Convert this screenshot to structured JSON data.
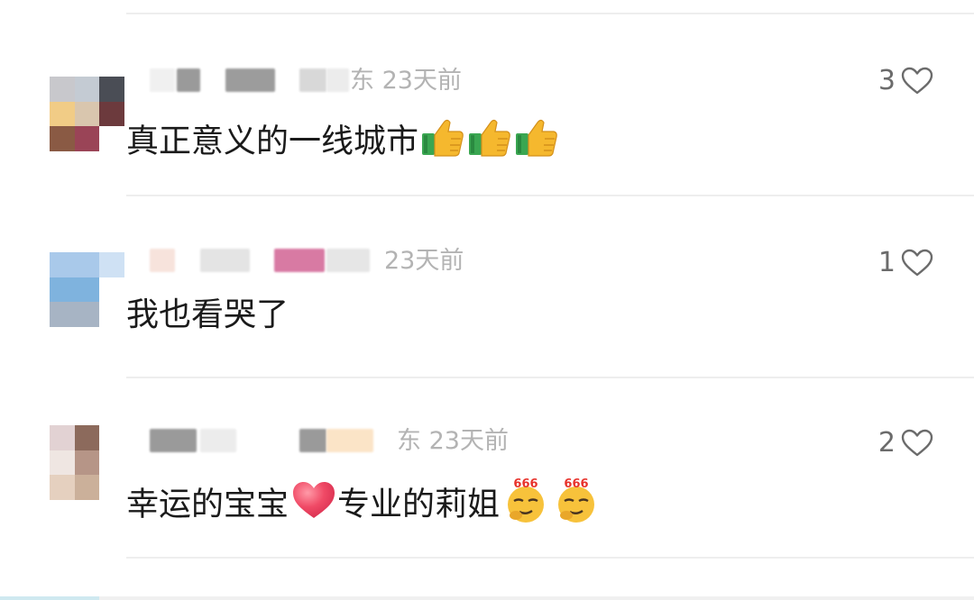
{
  "comments": [
    {
      "location_time": "东 23天前",
      "text": "真正意义的一线城市",
      "emoji": [
        "thumbs-up",
        "thumbs-up",
        "thumbs-up"
      ],
      "likes": "3"
    },
    {
      "location_time": "23天前",
      "text": "我也看哭了",
      "emoji": [],
      "likes": "1"
    },
    {
      "location_time": "东 23天前",
      "text_before": "幸运的宝宝",
      "text_after": "专业的莉姐",
      "emoji": [
        "red-heart",
        "666-smirk-face",
        "666-smirk-face"
      ],
      "likes": "2"
    }
  ],
  "colors": {
    "text": "#1a1a1a",
    "secondary": "#b3b3b3",
    "like_count": "#6b6b6b",
    "heart": "#ef4d6a"
  }
}
